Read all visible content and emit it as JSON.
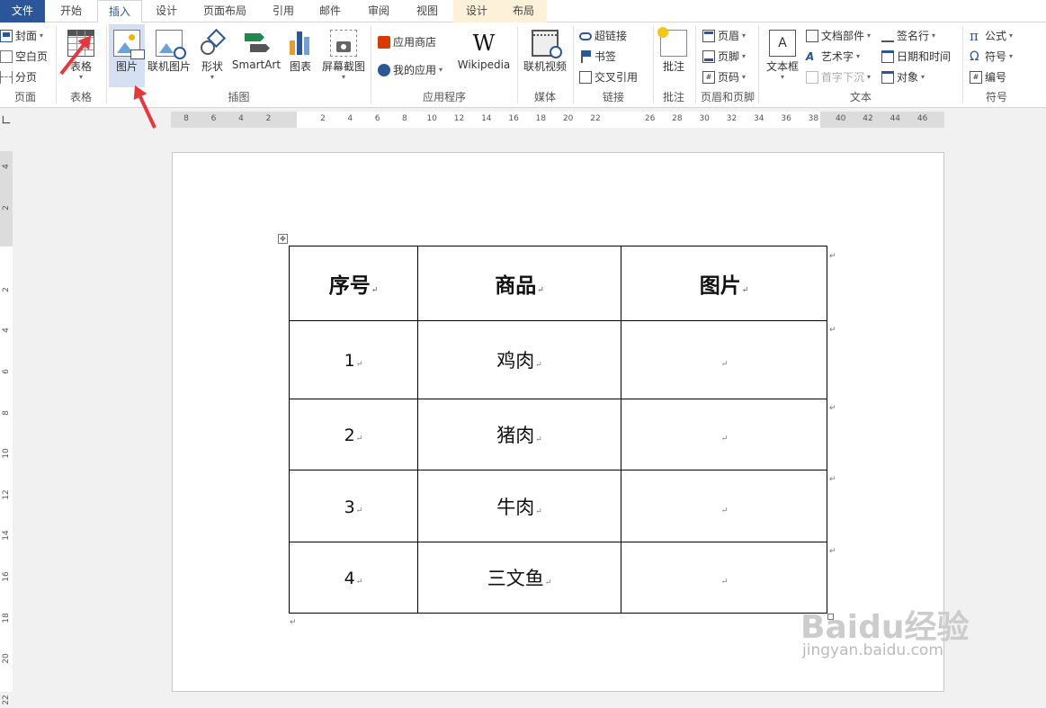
{
  "tabs": [
    {
      "label": "文件",
      "id": "file"
    },
    {
      "label": "开始"
    },
    {
      "label": "插入",
      "id": "active"
    },
    {
      "label": "设计"
    },
    {
      "label": "页面布局"
    },
    {
      "label": "引用"
    },
    {
      "label": "邮件"
    },
    {
      "label": "审阅"
    },
    {
      "label": "视图"
    },
    {
      "label": "设计",
      "id": "ctx"
    },
    {
      "label": "布局",
      "id": "ctx"
    }
  ],
  "ribbon": {
    "pages": {
      "cover": "封面",
      "blank": "空白页",
      "break": "分页",
      "group": "页面"
    },
    "tables": {
      "table": "表格",
      "group": "表格"
    },
    "illustrations": {
      "picture": "图片",
      "online_picture": "联机图片",
      "shapes": "形状",
      "smartart": "SmartArt",
      "chart": "图表",
      "screenshot": "屏幕截图",
      "group": "插图"
    },
    "apps": {
      "store": "应用商店",
      "my_apps": "我的应用",
      "wikipedia": "Wikipedia",
      "group": "应用程序"
    },
    "media": {
      "online_video": "联机视频",
      "group": "媒体"
    },
    "links": {
      "hyperlink": "超链接",
      "bookmark": "书签",
      "cross_ref": "交叉引用",
      "group": "链接"
    },
    "comments": {
      "comment": "批注",
      "group": "批注"
    },
    "header_footer": {
      "header": "页眉",
      "footer": "页脚",
      "page_number": "页码",
      "group": "页眉和页脚"
    },
    "text": {
      "textbox": "文本框",
      "quick_parts": "文档部件",
      "wordart": "艺术字",
      "dropcap": "首字下沉",
      "signature": "签名行",
      "datetime": "日期和时间",
      "object": "对象",
      "group": "文本"
    },
    "symbols": {
      "equation": "公式",
      "symbol": "符号",
      "number": "编号",
      "group": "符号"
    }
  },
  "ruler": {
    "h_left": [
      "8",
      "6",
      "4",
      "2"
    ],
    "h_main": [
      "2",
      "4",
      "6",
      "8",
      "10",
      "12",
      "14",
      "16",
      "18",
      "20",
      "22",
      "",
      "26",
      "28",
      "30",
      "32",
      "34",
      "36",
      "38",
      "40",
      "42",
      "44",
      "46"
    ],
    "v": [
      "4",
      "2",
      "",
      "2",
      "4",
      "6",
      "8",
      "10",
      "12",
      "14",
      "16",
      "18",
      "20",
      "22"
    ]
  },
  "table": {
    "headers": [
      "序号",
      "商品",
      "图片"
    ],
    "rows": [
      [
        "1",
        "鸡肉",
        ""
      ],
      [
        "2",
        "猪肉",
        ""
      ],
      [
        "3",
        "牛肉",
        ""
      ],
      [
        "4",
        "三文鱼",
        ""
      ]
    ]
  },
  "para_mark": "↵",
  "watermark": {
    "brand": "Baidu经验",
    "url": "jingyan.baidu.com"
  }
}
